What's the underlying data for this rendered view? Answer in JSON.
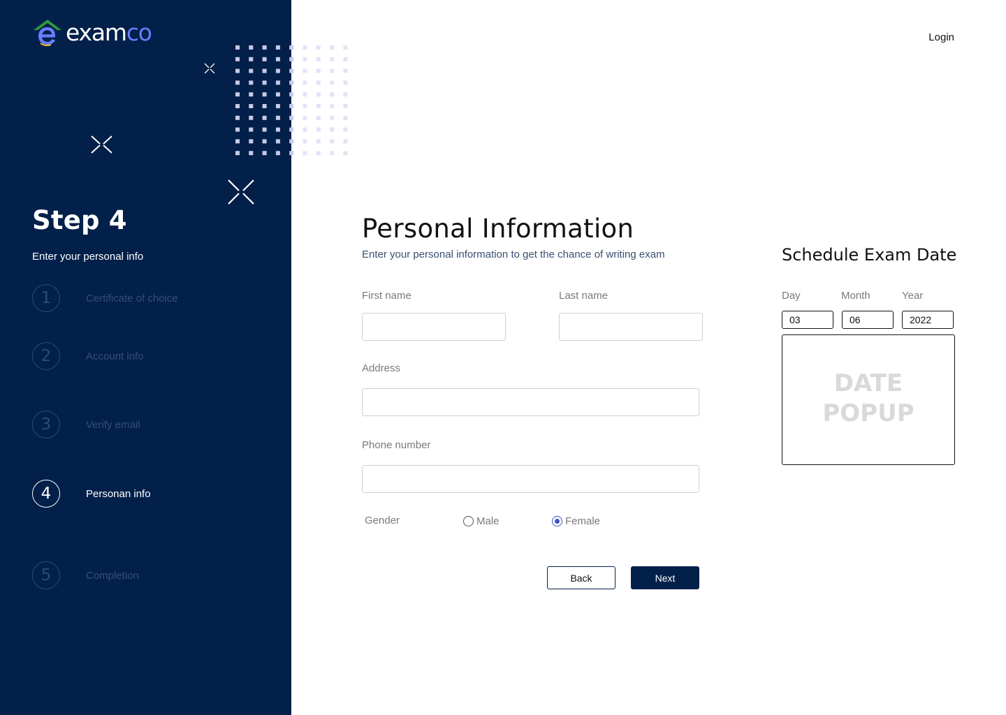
{
  "brand": {
    "name_main": "exam",
    "name_accent": "co"
  },
  "header": {
    "login_label": "Login"
  },
  "sidebar": {
    "step_title": "Step 4",
    "step_subtitle": "Enter your personal info",
    "steps": [
      {
        "number": "1",
        "label": "Certificate of choice",
        "active": false
      },
      {
        "number": "2",
        "label": "Account info",
        "active": false
      },
      {
        "number": "3",
        "label": "Verify email",
        "active": false
      },
      {
        "number": "4",
        "label": "Personan info",
        "active": true
      },
      {
        "number": "5",
        "label": "Completion",
        "active": false
      }
    ]
  },
  "form": {
    "title": "Personal Information",
    "subtitle": "Enter your personal information to get the chance of writing  exam",
    "first_name": {
      "label": "First name",
      "value": ""
    },
    "last_name": {
      "label": "Last name",
      "value": ""
    },
    "address": {
      "label": "Address",
      "value": ""
    },
    "phone": {
      "label": "Phone number",
      "value": ""
    },
    "gender": {
      "label": "Gender",
      "options": [
        "Male",
        "Female"
      ],
      "selected": "Female"
    },
    "back_label": "Back",
    "next_label": "Next"
  },
  "schedule": {
    "title": "Schedule Exam Date",
    "day": {
      "label": "Day",
      "value": "03"
    },
    "month": {
      "label": "Month",
      "value": "06"
    },
    "year": {
      "label": "Year",
      "value": "2022"
    },
    "popup_placeholder_line1": "DATE",
    "popup_placeholder_line2": "POPUP"
  },
  "colors": {
    "sidebar_bg": "#03204a",
    "accent": "#3a55c9",
    "logo_accent": "#6a7cff",
    "inactive_step": "#2c4a76"
  }
}
